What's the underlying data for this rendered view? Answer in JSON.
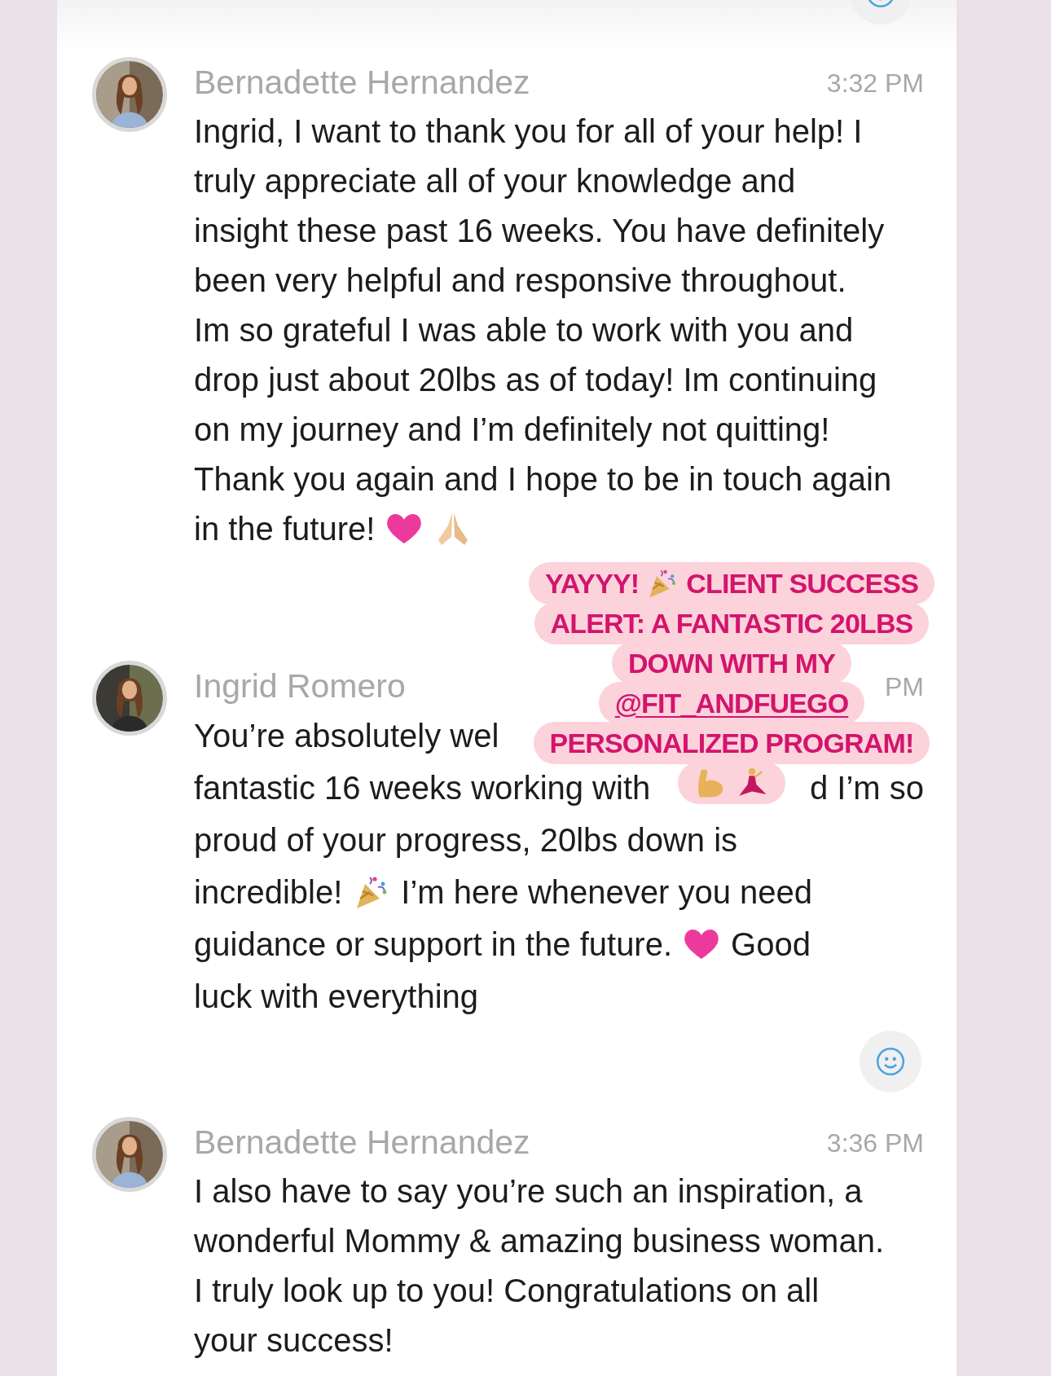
{
  "messages": [
    {
      "sender": "Bernadette Hernandez",
      "time": "3:32 PM",
      "lines": [
        [
          {
            "kind": "text",
            "text": "Ingrid, I want to thank you for all of your help! I"
          }
        ],
        [
          {
            "kind": "text",
            "text": "truly appreciate all of your knowledge and"
          }
        ],
        [
          {
            "kind": "text",
            "text": "insight these past 16 weeks. You have definitely"
          }
        ],
        [
          {
            "kind": "text",
            "text": "been very helpful and responsive throughout."
          }
        ],
        [
          {
            "kind": "text",
            "text": "Im so grateful I was able to work with you and"
          }
        ],
        [
          {
            "kind": "text",
            "text": "drop just about 20lbs as of today! Im continuing"
          }
        ],
        [
          {
            "kind": "text",
            "text": "on my journey and I’m definitely not quitting!"
          }
        ],
        [
          {
            "kind": "text",
            "text": "Thank you again and I hope to be in touch again"
          }
        ],
        [
          {
            "kind": "text",
            "text": "in the future!"
          },
          {
            "kind": "heart"
          },
          {
            "kind": "pray"
          }
        ]
      ]
    },
    {
      "sender": "Ingrid Romero",
      "time": "PM",
      "lines": [
        [
          {
            "kind": "text",
            "text": "You’re absolutely wel"
          }
        ],
        [
          {
            "kind": "text",
            "text": "fantastic 16 weeks working with"
          },
          {
            "kind": "gap"
          },
          {
            "kind": "text",
            "text": "d I’m so"
          }
        ],
        [
          {
            "kind": "text",
            "text": "proud of your progress, 20lbs down is"
          }
        ],
        [
          {
            "kind": "text",
            "text": "incredible!"
          },
          {
            "kind": "party"
          },
          {
            "kind": "text",
            "text": "I’m here whenever you need"
          }
        ],
        [
          {
            "kind": "text",
            "text": "guidance or support in the future."
          },
          {
            "kind": "heart"
          },
          {
            "kind": "text",
            "text": "Good"
          }
        ],
        [
          {
            "kind": "text",
            "text": "luck with everything"
          }
        ]
      ]
    },
    {
      "sender": "Bernadette Hernandez",
      "time": "3:36 PM",
      "lines": [
        [
          {
            "kind": "text",
            "text": "I also have to say you’re such an inspiration, a"
          }
        ],
        [
          {
            "kind": "text",
            "text": "wonderful Mommy & amazing business woman."
          }
        ],
        [
          {
            "kind": "text",
            "text": "I truly look up to you! Congratulations on all"
          }
        ],
        [
          {
            "kind": "text",
            "text": "your success!"
          }
        ]
      ]
    }
  ],
  "sticker": {
    "lines": [
      [
        {
          "kind": "text",
          "text": "YAYYY!"
        },
        {
          "kind": "party"
        },
        {
          "kind": "text",
          "text": "CLIENT SUCCESS"
        }
      ],
      [
        {
          "kind": "text",
          "text": "ALERT: A FANTASTIC 20LBS"
        }
      ],
      [
        {
          "kind": "text",
          "text": "DOWN WITH MY"
        }
      ],
      [
        {
          "kind": "mention",
          "text": "@FIT_ANDFUEGO"
        }
      ],
      [
        {
          "kind": "text",
          "text": "PERSONALIZED PROGRAM!"
        }
      ],
      [
        {
          "kind": "muscle"
        },
        {
          "kind": "dancer"
        }
      ]
    ]
  }
}
